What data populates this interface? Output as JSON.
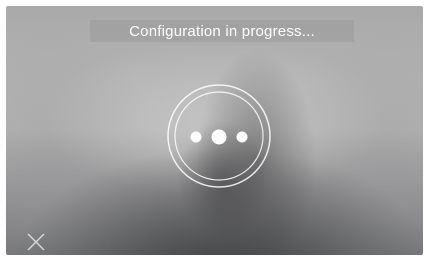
{
  "status": {
    "message": "Configuration in progress..."
  },
  "progress_indicator": {
    "icon": "loading-dots-icon",
    "dot_color": "#ffffff",
    "ring_color": "#ffffff"
  },
  "close_button": {
    "icon": "close-icon",
    "color": "#d9d9d9"
  }
}
